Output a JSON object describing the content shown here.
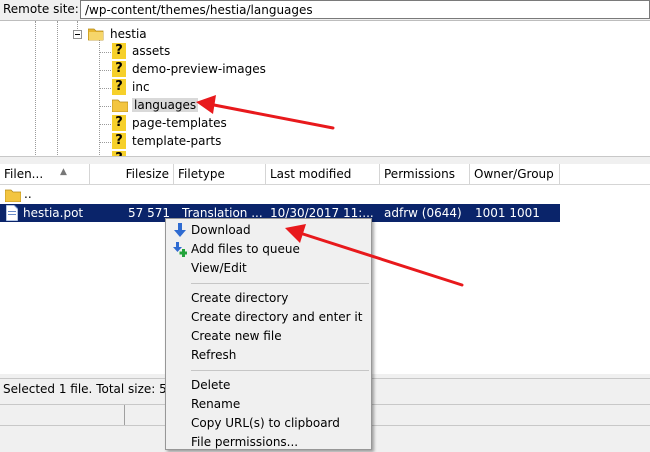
{
  "remote": {
    "label": "Remote site:",
    "path": "/wp-content/themes/hestia/languages"
  },
  "tree": {
    "root": "hestia",
    "children": [
      {
        "label": "assets",
        "icon": "unknown-folder-icon"
      },
      {
        "label": "demo-preview-images",
        "icon": "unknown-folder-icon"
      },
      {
        "label": "inc",
        "icon": "unknown-folder-icon"
      },
      {
        "label": "languages",
        "icon": "folder-icon",
        "selected": true
      },
      {
        "label": "page-templates",
        "icon": "unknown-folder-icon"
      },
      {
        "label": "template-parts",
        "icon": "unknown-folder-icon"
      }
    ]
  },
  "filelist": {
    "columns": [
      "Filen...",
      "Filesize",
      "Filetype",
      "Last modified",
      "Permissions",
      "Owner/Group"
    ],
    "parent_row": "..",
    "rows": [
      {
        "name": "hestia.pot",
        "size": "57 571",
        "type": "Translation ...",
        "modified": "10/30/2017 11:...",
        "permissions": "adfrw (0644)",
        "owner": "1001 1001"
      }
    ]
  },
  "status": {
    "text": "Selected 1 file. Total size: 57 5"
  },
  "context_menu": {
    "items": [
      {
        "label": "Download",
        "icon": "download-arrow-icon"
      },
      {
        "label": "Add files to queue",
        "icon": "add-to-queue-icon"
      },
      {
        "label": "View/Edit"
      },
      {
        "separator": true
      },
      {
        "label": "Create directory"
      },
      {
        "label": "Create directory and enter it"
      },
      {
        "label": "Create new file"
      },
      {
        "label": "Refresh"
      },
      {
        "separator": true
      },
      {
        "label": "Delete"
      },
      {
        "label": "Rename"
      },
      {
        "label": "Copy URL(s) to clipboard"
      },
      {
        "label": "File permissions..."
      }
    ]
  },
  "colors": {
    "selection": "#0a246a",
    "annotation_arrow": "#e8191c",
    "folder": "#f6c94a"
  }
}
